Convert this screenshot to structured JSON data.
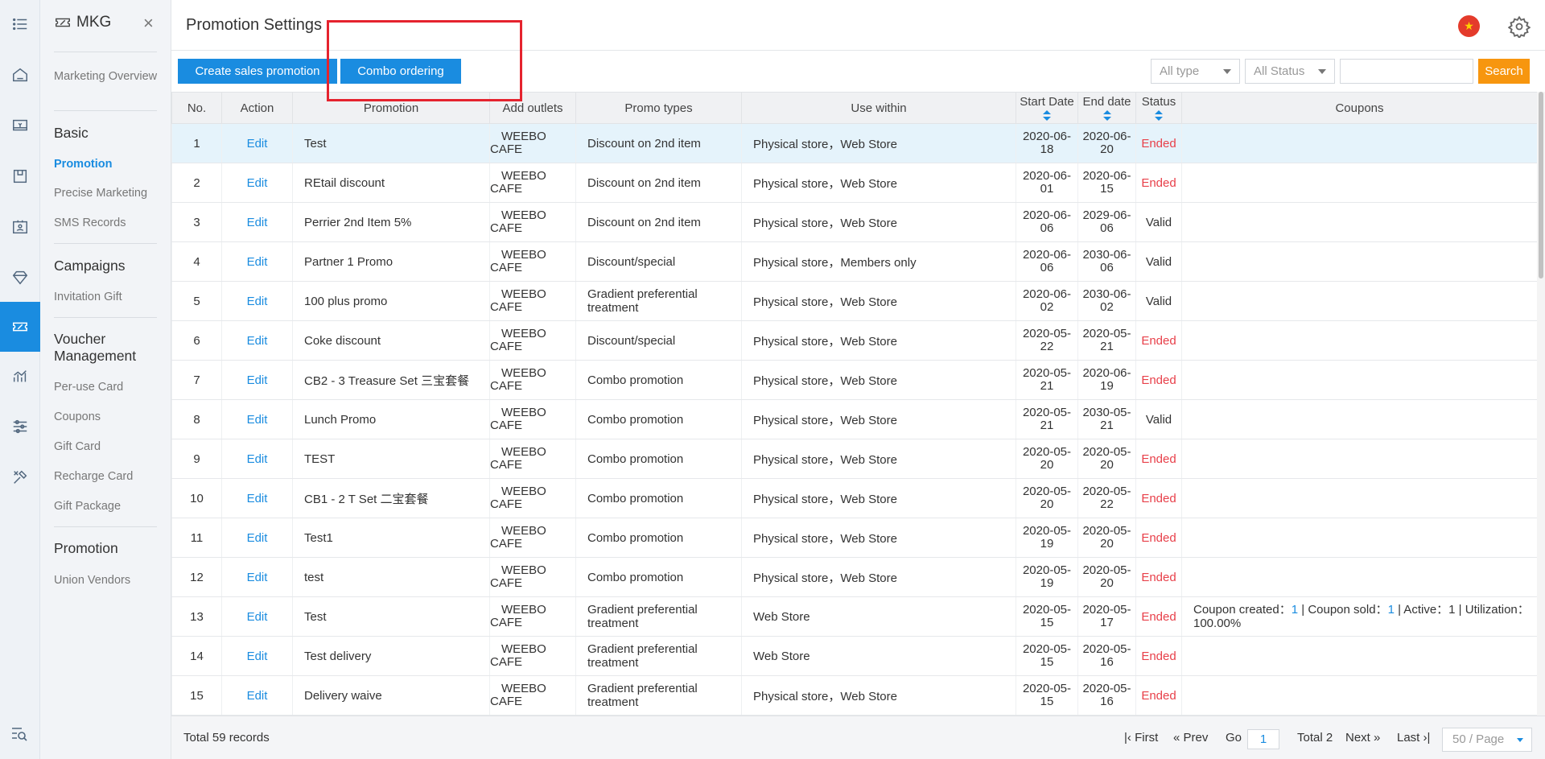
{
  "app": {
    "name": "MKG"
  },
  "iconbar": [
    "menu-icon",
    "home-icon",
    "cash-register-icon",
    "inventory-icon",
    "member-card-icon",
    "diamond-icon",
    "marketing-ticket-icon",
    "analytics-icon",
    "settings-sliders-icon",
    "tools-icon",
    "search-list-icon"
  ],
  "sidebar": {
    "overview": "Marketing Overview",
    "sections": [
      {
        "title": "Basic",
        "items": [
          "Promotion",
          "Precise Marketing",
          "SMS Records"
        ]
      },
      {
        "title": "Campaigns",
        "items": [
          "Invitation Gift"
        ]
      },
      {
        "title": "Voucher Management",
        "items": [
          "Per-use Card",
          "Coupons",
          "Gift Card",
          "Recharge Card",
          "Gift Package"
        ]
      },
      {
        "title": "Promotion",
        "items": [
          "Union Vendors"
        ]
      }
    ]
  },
  "header": {
    "title": "Promotion Settings",
    "close": "×"
  },
  "toolbar": {
    "create_label": "Create sales promotion",
    "combo_label": "Combo ordering",
    "type_filter": "All type",
    "status_filter": "All Status",
    "search_value": "",
    "search_label": "Search"
  },
  "table": {
    "columns": [
      "No.",
      "Action",
      "Promotion",
      "Add outlets",
      "Promo types",
      "Use within",
      "Start Date",
      "End date",
      "Status",
      "Coupons"
    ],
    "rows": [
      {
        "no": "1",
        "action": "Edit",
        "promotion": "Test",
        "outlet": "WEEBO CAFE",
        "type": "Discount on 2nd item",
        "use": "Physical store，Web Store",
        "start": "2020-06-18",
        "end": "2020-06-20",
        "status": "Ended",
        "coupons": ""
      },
      {
        "no": "2",
        "action": "Edit",
        "promotion": "REtail discount",
        "outlet": "WEEBO CAFE",
        "type": "Discount on 2nd item",
        "use": "Physical store，Web Store",
        "start": "2020-06-01",
        "end": "2020-06-15",
        "status": "Ended",
        "coupons": ""
      },
      {
        "no": "3",
        "action": "Edit",
        "promotion": "Perrier 2nd Item 5%",
        "outlet": "WEEBO CAFE",
        "type": "Discount on 2nd item",
        "use": "Physical store，Web Store",
        "start": "2020-06-06",
        "end": "2029-06-06",
        "status": "Valid",
        "coupons": ""
      },
      {
        "no": "4",
        "action": "Edit",
        "promotion": "Partner 1 Promo",
        "outlet": "WEEBO CAFE",
        "type": "Discount/special",
        "use": "Physical store，Members only",
        "start": "2020-06-06",
        "end": "2030-06-06",
        "status": "Valid",
        "coupons": ""
      },
      {
        "no": "5",
        "action": "Edit",
        "promotion": "100 plus promo",
        "outlet": "WEEBO CAFE",
        "type": "Gradient preferential treatment",
        "use": "Physical store，Web Store",
        "start": "2020-06-02",
        "end": "2030-06-02",
        "status": "Valid",
        "coupons": ""
      },
      {
        "no": "6",
        "action": "Edit",
        "promotion": "Coke discount",
        "outlet": "WEEBO CAFE",
        "type": "Discount/special",
        "use": "Physical store，Web Store",
        "start": "2020-05-22",
        "end": "2020-05-21",
        "status": "Ended",
        "coupons": ""
      },
      {
        "no": "7",
        "action": "Edit",
        "promotion": "CB2 - 3 Treasure Set 三宝套餐",
        "outlet": "WEEBO CAFE",
        "type": "Combo promotion",
        "use": "Physical store，Web Store",
        "start": "2020-05-21",
        "end": "2020-06-19",
        "status": "Ended",
        "coupons": ""
      },
      {
        "no": "8",
        "action": "Edit",
        "promotion": "Lunch Promo",
        "outlet": "WEEBO CAFE",
        "type": "Combo promotion",
        "use": "Physical store，Web Store",
        "start": "2020-05-21",
        "end": "2030-05-21",
        "status": "Valid",
        "coupons": ""
      },
      {
        "no": "9",
        "action": "Edit",
        "promotion": "TEST",
        "outlet": "WEEBO CAFE",
        "type": "Combo promotion",
        "use": "Physical store，Web Store",
        "start": "2020-05-20",
        "end": "2020-05-20",
        "status": "Ended",
        "coupons": ""
      },
      {
        "no": "10",
        "action": "Edit",
        "promotion": "CB1 - 2 T Set 二宝套餐",
        "outlet": "WEEBO CAFE",
        "type": "Combo promotion",
        "use": "Physical store，Web Store",
        "start": "2020-05-20",
        "end": "2020-05-22",
        "status": "Ended",
        "coupons": ""
      },
      {
        "no": "11",
        "action": "Edit",
        "promotion": "Test1",
        "outlet": "WEEBO CAFE",
        "type": "Combo promotion",
        "use": "Physical store，Web Store",
        "start": "2020-05-19",
        "end": "2020-05-20",
        "status": "Ended",
        "coupons": ""
      },
      {
        "no": "12",
        "action": "Edit",
        "promotion": "test",
        "outlet": "WEEBO CAFE",
        "type": "Combo promotion",
        "use": "Physical store，Web Store",
        "start": "2020-05-19",
        "end": "2020-05-20",
        "status": "Ended",
        "coupons": ""
      },
      {
        "no": "13",
        "action": "Edit",
        "promotion": "Test",
        "outlet": "WEEBO CAFE",
        "type": "Gradient preferential treatment",
        "use": "Web Store",
        "start": "2020-05-15",
        "end": "2020-05-17",
        "status": "Ended",
        "coupons": "Coupon created：1 | Coupon sold：1 | Active：1 | Utilization：100.00%"
      },
      {
        "no": "14",
        "action": "Edit",
        "promotion": "Test delivery",
        "outlet": "WEEBO CAFE",
        "type": "Gradient preferential treatment",
        "use": "Web Store",
        "start": "2020-05-15",
        "end": "2020-05-16",
        "status": "Ended",
        "coupons": ""
      },
      {
        "no": "15",
        "action": "Edit",
        "promotion": "Delivery waive",
        "outlet": "WEEBO CAFE",
        "type": "Gradient preferential treatment",
        "use": "Physical store，Web Store",
        "start": "2020-05-15",
        "end": "2020-05-16",
        "status": "Ended",
        "coupons": ""
      }
    ]
  },
  "coupon_detail": {
    "created_label": "Coupon created：",
    "created": "1",
    "sold_label": " | Coupon sold：",
    "sold": "1",
    "rest": " | Active：1 | Utilization：100.00%"
  },
  "footer": {
    "total_records": "Total 59 records",
    "first": "First",
    "prev": "Prev",
    "go": "Go",
    "page": "1",
    "total_pages": "Total 2",
    "next": "Next",
    "last": "Last",
    "page_size": "50 / Page"
  },
  "colors": {
    "accent": "#1a8ce0",
    "ended": "#e8404a",
    "search": "#f7960f",
    "highlight": "#e5232e"
  }
}
